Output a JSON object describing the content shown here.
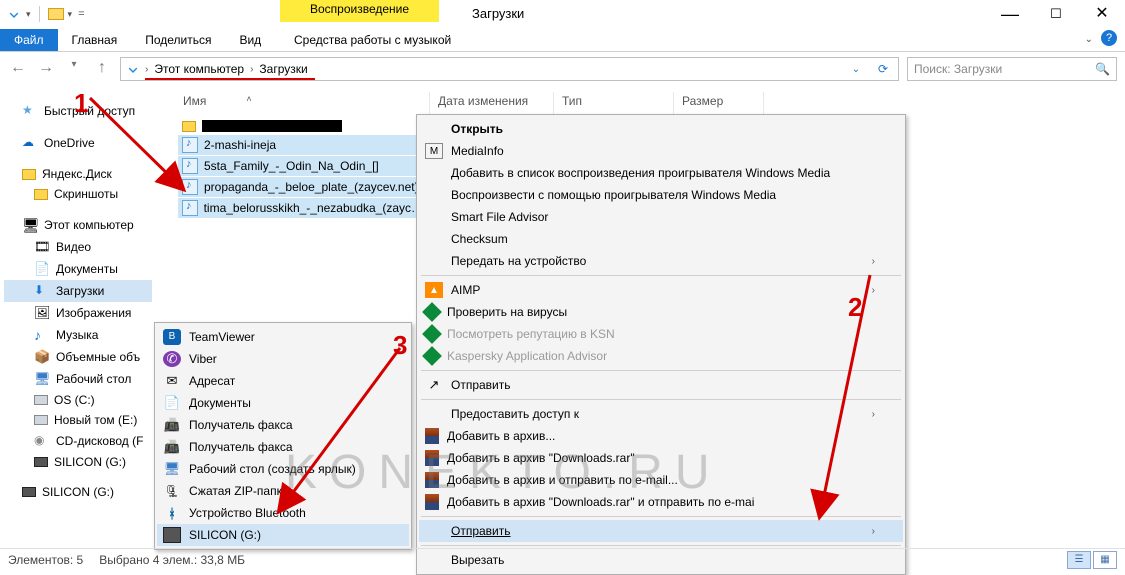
{
  "window": {
    "title": "Загрузки"
  },
  "ribbon": {
    "playback": "Воспроизведение",
    "tools": "Средства работы с музыкой",
    "tabs": {
      "file": "Файл",
      "home": "Главная",
      "share": "Поделиться",
      "view": "Вид"
    }
  },
  "nav": {
    "breadcrumb": [
      "Этот компьютер",
      "Загрузки"
    ],
    "search_placeholder": "Поиск: Загрузки"
  },
  "columns": {
    "name": "Имя",
    "date": "Дата изменения",
    "type": "Тип",
    "size": "Размер"
  },
  "tree": [
    {
      "icon": "star",
      "label": "Быстрый доступ"
    },
    {
      "sp": true
    },
    {
      "icon": "cloud",
      "label": "OneDrive"
    },
    {
      "sp": true
    },
    {
      "icon": "yd",
      "label": "Яндекс.Диск"
    },
    {
      "icon": "folder",
      "label": "Скриншоты",
      "indent": true
    },
    {
      "sp": true
    },
    {
      "icon": "pc",
      "label": "Этот компьютер"
    },
    {
      "icon": "video",
      "label": "Видео",
      "indent": true
    },
    {
      "icon": "doc",
      "label": "Документы",
      "indent": true
    },
    {
      "icon": "down",
      "label": "Загрузки",
      "indent": true,
      "selected": true
    },
    {
      "icon": "pic",
      "label": "Изображения",
      "indent": true
    },
    {
      "icon": "music",
      "label": "Музыка",
      "indent": true
    },
    {
      "icon": "vol",
      "label": "Объемные объ",
      "indent": true
    },
    {
      "icon": "desk",
      "label": "Рабочий стол",
      "indent": true
    },
    {
      "icon": "drive",
      "label": "OS (C:)",
      "indent": true
    },
    {
      "icon": "drive",
      "label": "Новый том (E:)",
      "indent": true
    },
    {
      "icon": "cd",
      "label": "CD-дисковод (F",
      "indent": true
    },
    {
      "icon": "usb",
      "label": "SILICON (G:)",
      "indent": true
    },
    {
      "sp": true
    },
    {
      "icon": "usb",
      "label": "SILICON (G:)"
    }
  ],
  "files": [
    {
      "folder": true,
      "redacted": true
    },
    {
      "name": "2-mashi-ineja",
      "sel": true
    },
    {
      "name": "5sta_Family_-_Odin_Na_Odin_[]",
      "sel": true
    },
    {
      "name": "propaganda_-_beloe_plate_(zaycev.net)",
      "sel": true
    },
    {
      "name": "tima_belorusskikh_-_nezabudka_(zaycev...",
      "sel": true
    }
  ],
  "sendto": [
    {
      "icon": "tv",
      "label": "TeamViewer",
      "t": "B"
    },
    {
      "icon": "viber",
      "label": "Viber",
      "t": "✆"
    },
    {
      "icon": "mail",
      "label": "Адресат"
    },
    {
      "icon": "doc",
      "label": "Документы"
    },
    {
      "icon": "fax",
      "label": "Получатель факса"
    },
    {
      "icon": "fax",
      "label": "Получатель факса"
    },
    {
      "icon": "desk",
      "label": "Рабочий стол (создать ярлык)"
    },
    {
      "icon": "zip",
      "label": "Сжатая ZIP-папка"
    },
    {
      "icon": "bt",
      "label": "Устройство Bluetooth"
    },
    {
      "icon": "usb",
      "label": "SILICON (G:)",
      "hover": true
    }
  ],
  "ctx": [
    {
      "label": "Открыть",
      "bold": true
    },
    {
      "icon": "mi",
      "label": "MediaInfo",
      "t": "M"
    },
    {
      "label": "Добавить в список воспроизведения проигрывателя Windows Media"
    },
    {
      "label": "Воспроизвести с помощью проигрывателя Windows Media"
    },
    {
      "label": "Smart File Advisor"
    },
    {
      "label": "Checksum"
    },
    {
      "label": "Передать на устройство",
      "sub": true
    },
    {
      "sep": true
    },
    {
      "icon": "aimp",
      "label": "AIMP",
      "t": "▲",
      "sub": true
    },
    {
      "icon": "kasp",
      "label": "Проверить на вирусы"
    },
    {
      "icon": "kasp",
      "label": "Посмотреть репутацию в KSN",
      "disabled": true
    },
    {
      "icon": "kasp",
      "label": "Kaspersky Application Advisor",
      "disabled": true
    },
    {
      "sep": true
    },
    {
      "icon": "share",
      "label": "Отправить"
    },
    {
      "sep": true
    },
    {
      "label": "Предоставить доступ к",
      "sub": true
    },
    {
      "icon": "rar",
      "label": "Добавить в архив..."
    },
    {
      "icon": "rar",
      "label": "Добавить в архив \"Downloads.rar\""
    },
    {
      "icon": "rar",
      "label": "Добавить в архив и отправить по e-mail..."
    },
    {
      "icon": "rar",
      "label": "Добавить в архив \"Downloads.rar\" и отправить по e-mai"
    },
    {
      "sep": true
    },
    {
      "label": "Отправить",
      "sub": true,
      "hover": true,
      "u": true
    },
    {
      "sep": true
    },
    {
      "label": "Вырезать"
    }
  ],
  "status": {
    "count": "Элементов: 5",
    "sel": "Выбрано 4 элем.: 33,8 МБ"
  },
  "callouts": {
    "a": "1",
    "b": "2",
    "c": "3"
  },
  "watermark": "KONEKTO.RU"
}
